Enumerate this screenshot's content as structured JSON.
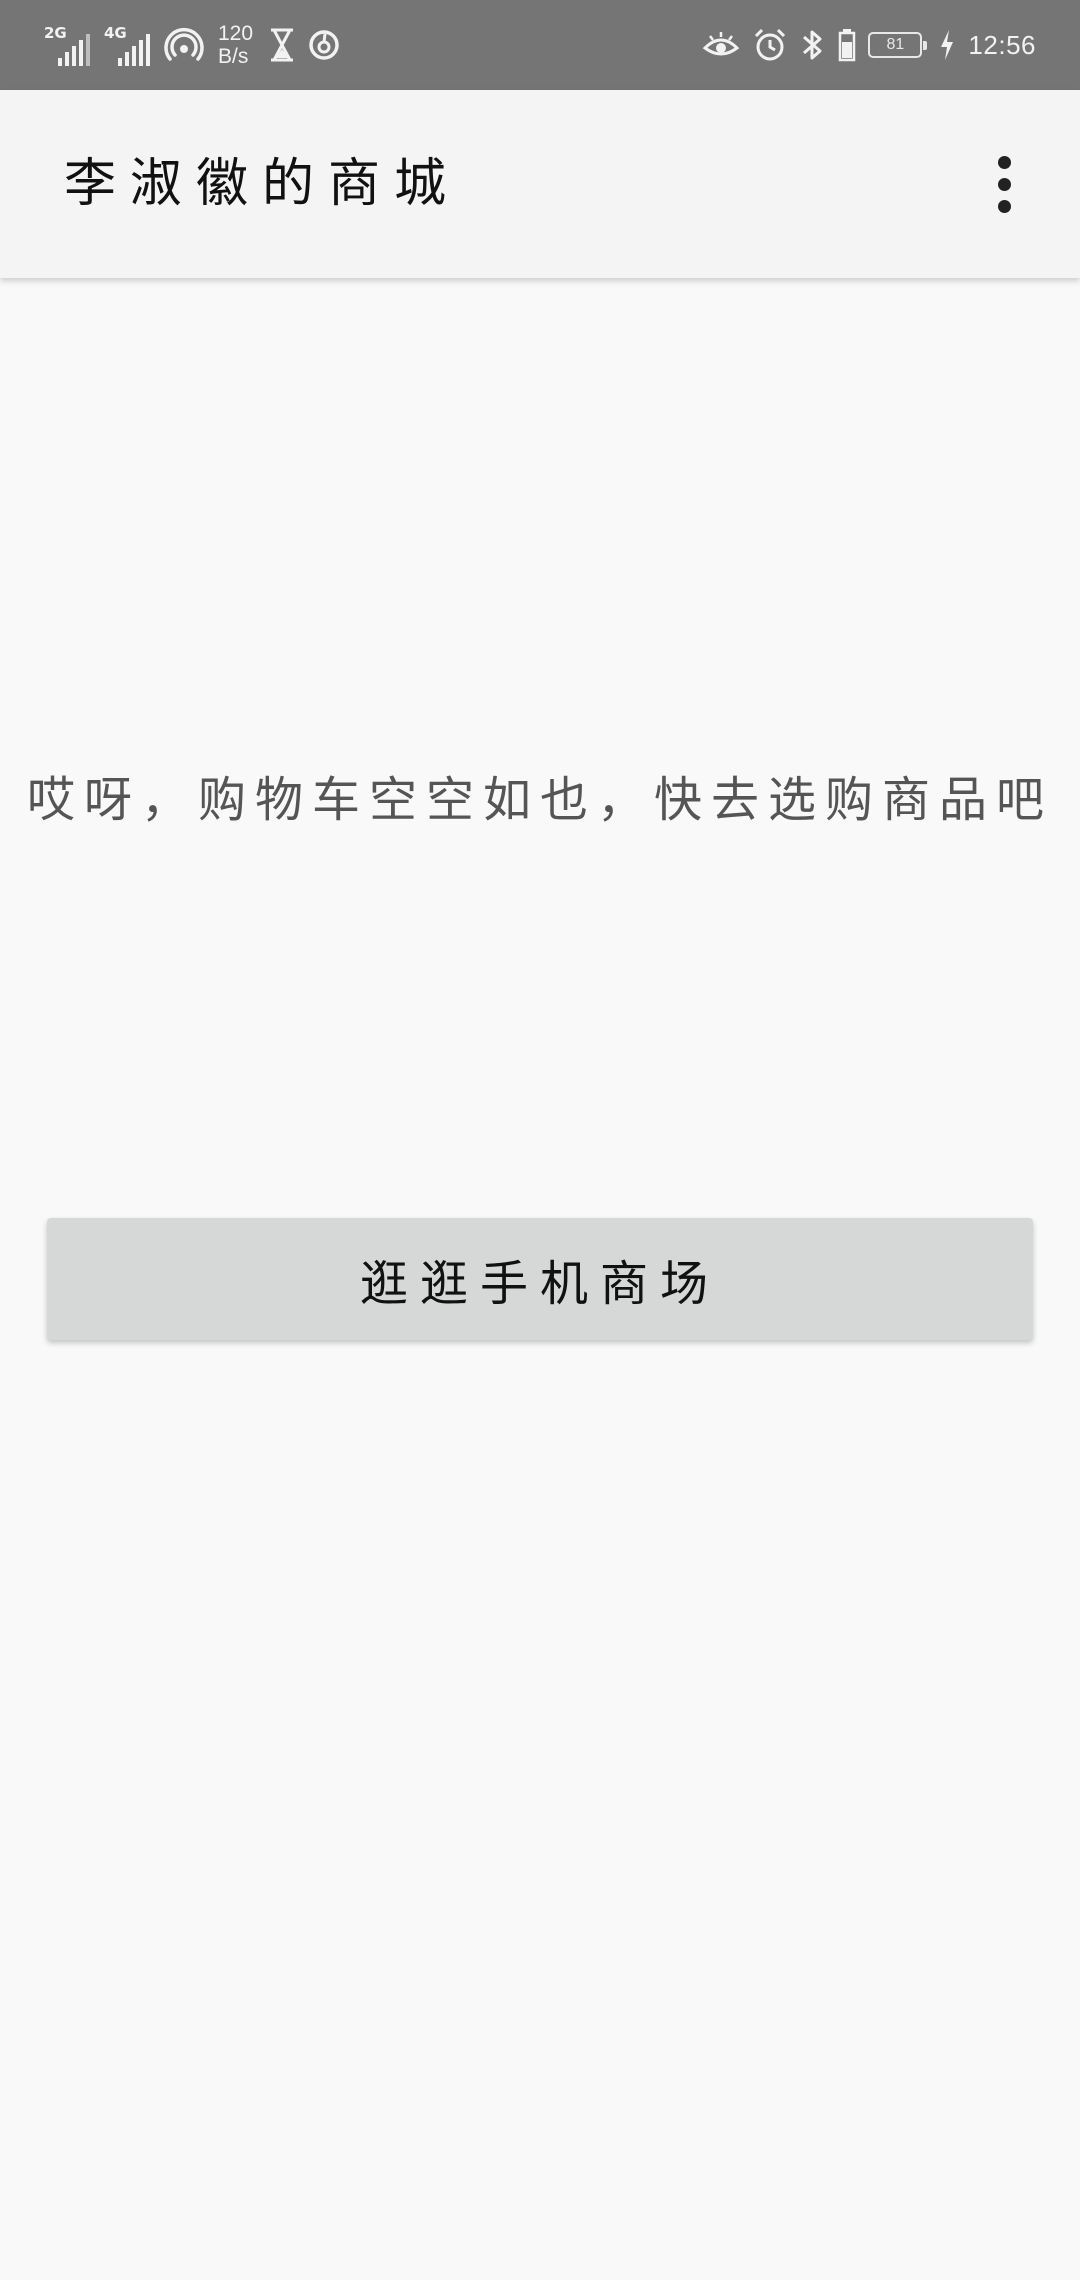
{
  "status_bar": {
    "sim1_tag": "2G",
    "sim2_tag": "4G",
    "net_speed_value": "120",
    "net_speed_unit": "B/s",
    "battery_level": "81",
    "time": "12:56",
    "icons": [
      "signal-icon",
      "signal-icon",
      "hotspot-icon",
      "hourglass-icon",
      "netease-music-icon",
      "eye-comfort-icon",
      "alarm-icon",
      "bluetooth-icon",
      "battery-icon",
      "charging-icon"
    ]
  },
  "app_bar": {
    "title": "李淑徽的商城",
    "menu_icon": "more-vert-icon"
  },
  "cart": {
    "empty_message": "哎呀，购物车空空如也，快去选购商品吧",
    "browse_button_label": "逛逛手机商场"
  },
  "colors": {
    "status_bar_bg": "#757575",
    "app_bar_bg": "#f4f4f4",
    "page_bg": "#f9f9f9",
    "button_bg": "#d6d7d7"
  }
}
